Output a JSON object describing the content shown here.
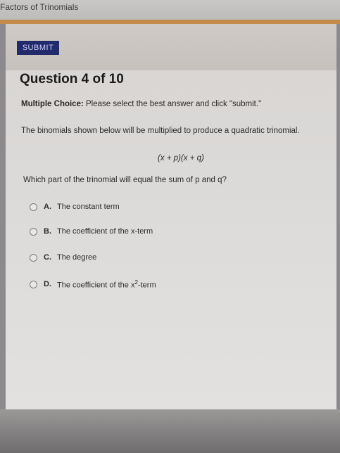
{
  "window": {
    "title": "Factors of Trinomials"
  },
  "toolbar": {
    "submit_label": "SUBMIT"
  },
  "question": {
    "title": "Question 4 of 10",
    "instruction_prefix": "Multiple Choice:",
    "instruction_text": "Please select the best answer and click \"submit.\"",
    "prompt": "The binomials shown below will be multiplied to produce a quadratic trinomial.",
    "expression": "(x + p)(x + q)",
    "text": "Which part of the trinomial will equal the sum of p and q?"
  },
  "choices": [
    {
      "letter": "A.",
      "text": "The constant term"
    },
    {
      "letter": "B.",
      "text": "The coefficient of the x-term"
    },
    {
      "letter": "C.",
      "text": "The degree"
    },
    {
      "letter": "D.",
      "text_before": "The coefficient of the x",
      "superscript": "2",
      "text_after": "-term"
    }
  ],
  "colors": {
    "submit_bg": "#232a6b",
    "accent_line": "#c48a4a"
  },
  "icons": [
    "radio-button-icon"
  ]
}
